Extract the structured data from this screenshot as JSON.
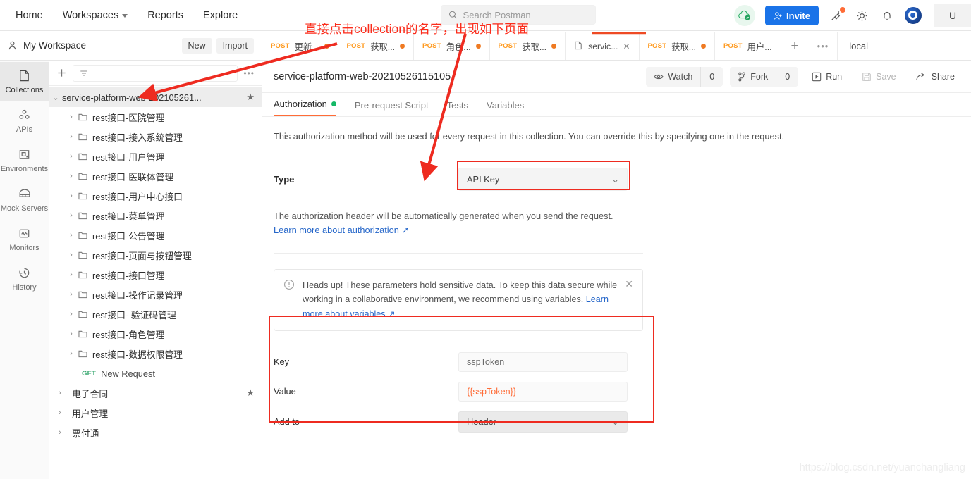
{
  "topnav": {
    "items": [
      {
        "label": "Home",
        "caret": false
      },
      {
        "label": "Workspaces",
        "caret": true
      },
      {
        "label": "Reports",
        "caret": false
      },
      {
        "label": "Explore",
        "caret": false
      }
    ],
    "search_placeholder": "Search Postman",
    "search_value": "",
    "invite_label": "Invite",
    "user_initial": "U",
    "icons": [
      "cloud-sync-icon",
      "invite-icon",
      "satellite-icon",
      "gear-icon",
      "bell-icon",
      "postman-avatar"
    ]
  },
  "workspace": {
    "name": "My Workspace",
    "new_label": "New",
    "import_label": "Import"
  },
  "rail": {
    "items": [
      {
        "label": "Collections",
        "icon": "collection-icon",
        "active": true
      },
      {
        "label": "APIs",
        "icon": "apis-icon",
        "active": false
      },
      {
        "label": "Environments",
        "icon": "environments-icon",
        "active": false
      },
      {
        "label": "Mock Servers",
        "icon": "mock-servers-icon",
        "active": false
      },
      {
        "label": "Monitors",
        "icon": "monitors-icon",
        "active": false
      },
      {
        "label": "History",
        "icon": "history-icon",
        "active": false
      }
    ]
  },
  "sidebar": {
    "filter_placeholder": "",
    "collection": {
      "name": "service-platform-web-202105261...",
      "starred": true,
      "expanded": true
    },
    "folders": [
      "rest接口-医院管理",
      "rest接口-接入系统管理",
      "rest接口-用户管理",
      "rest接口-医联体管理",
      "rest接口-用户中心接口",
      "rest接口-菜单管理",
      "rest接口-公告管理",
      "rest接口-页面与按钮管理",
      "rest接口-接口管理",
      "rest接口-操作记录管理",
      "rest接口- 验证码管理",
      "rest接口-角色管理",
      "rest接口-数据权限管理"
    ],
    "request": {
      "method": "GET",
      "name": "New Request"
    },
    "other_collections": [
      {
        "name": "电子合同",
        "starred": true
      },
      {
        "name": "用户管理",
        "starred": false
      },
      {
        "name": "票付通",
        "starred": false
      }
    ]
  },
  "tabstrip": {
    "tabs": [
      {
        "method": "POST",
        "title": "更新...",
        "dirty": true,
        "active": false,
        "type": "request"
      },
      {
        "method": "POST",
        "title": "获取...",
        "dirty": true,
        "active": false,
        "type": "request"
      },
      {
        "method": "POST",
        "title": "角色...",
        "dirty": true,
        "active": false,
        "type": "request"
      },
      {
        "method": "POST",
        "title": "获取...",
        "dirty": true,
        "active": false,
        "type": "request"
      },
      {
        "method": "",
        "title": "servic...",
        "dirty": false,
        "active": true,
        "type": "collection"
      },
      {
        "method": "POST",
        "title": "获取...",
        "dirty": true,
        "active": false,
        "type": "request"
      },
      {
        "method": "POST",
        "title": "用户...",
        "dirty": false,
        "active": false,
        "type": "request"
      }
    ],
    "add_label": "+",
    "more_label": "•••",
    "environment": "local"
  },
  "collection_header": {
    "title": "service-platform-web-20210526115105",
    "watch_label": "Watch",
    "watch_count": "0",
    "fork_label": "Fork",
    "fork_count": "0",
    "run_label": "Run",
    "save_label": "Save",
    "share_label": "Share"
  },
  "subtabs": [
    {
      "label": "Authorization",
      "active": true,
      "dot": true
    },
    {
      "label": "Pre-request Script",
      "active": false,
      "dot": false
    },
    {
      "label": "Tests",
      "active": false,
      "dot": false
    },
    {
      "label": "Variables",
      "active": false,
      "dot": false
    }
  ],
  "auth": {
    "description": "This authorization method will be used for every request in this collection. You can override this by specifying one in the request.",
    "type_label": "Type",
    "type_value": "API Key",
    "note": "The authorization header will be automatically generated when you send the request.",
    "note_link": "Learn more about authorization ↗",
    "headsup_text": "Heads up! These parameters hold sensitive data. To keep this data secure while working in a collaborative environment, we recommend using variables. ",
    "headsup_link": "Learn more about variables ↗",
    "key_label": "Key",
    "key_value": "sspToken",
    "value_label": "Value",
    "value_value": "{{sspToken}}",
    "addto_label": "Add to",
    "addto_value": "Header"
  },
  "annotations": {
    "text": "直接点击collection的名字，出现如下页面",
    "color": "#fb2c1b",
    "box_color": "#ee2b20"
  },
  "watermark": "https://blog.csdn.net/yuanchangliang"
}
